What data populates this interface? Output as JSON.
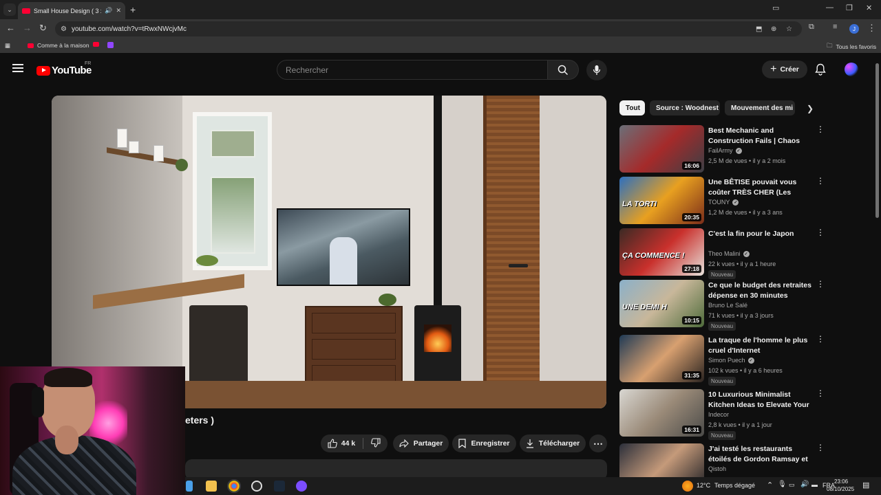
{
  "browser": {
    "tab_title": "Small House Design ( 3 x 7",
    "url": "youtube.com/watch?v=tRwxNWcjvMc",
    "bookmarks": [
      {
        "label": "Comme à la maison",
        "icon": "youtube-icon"
      },
      {
        "label": "",
        "icon": "youtube-icon"
      },
      {
        "label": "",
        "icon": "twitch-icon"
      }
    ],
    "all_bookmarks_label": "Tous les favoris"
  },
  "youtube": {
    "logo_text": "YouTube",
    "region": "FR",
    "search_placeholder": "Rechercher",
    "create_label": "Créer"
  },
  "video": {
    "title_visible": "eters )",
    "likes": "44 k",
    "share_label": "Partager",
    "save_label": "Enregistrer",
    "download_label": "Télécharger"
  },
  "chips": [
    "Tout",
    "Source : Woodnest",
    "Mouvement des mi"
  ],
  "recommendations": [
    {
      "title": "Best Mechanic and Construction Fails | Chaos and...",
      "channel": "FailArmy",
      "verified": true,
      "views": "2,5 M de vues",
      "age": "il y a 2 mois",
      "duration": "16:06",
      "badge": "",
      "thumb_caption": "",
      "colors": [
        "#6b6f78",
        "#a52a2a",
        "#3b3f45"
      ]
    },
    {
      "title": "Une BÊTISE pouvait vous coûter TRÈS CHER (Les machines de ...",
      "channel": "TOUNY",
      "verified": true,
      "views": "1,2 M de vues",
      "age": "il y a 3 ans",
      "duration": "20:35",
      "badge": "",
      "thumb_caption": "LA TORTI",
      "colors": [
        "#2c6fbf",
        "#e8a020",
        "#7a2c1a"
      ]
    },
    {
      "title": "C'est la fin pour le Japon",
      "channel": "Theo Malini",
      "verified": true,
      "views": "22 k vues",
      "age": "il y a 1 heure",
      "duration": "27:18",
      "badge": "Nouveau",
      "thumb_caption": "ÇA COMMENCE !",
      "colors": [
        "#3a2a24",
        "#c9302c",
        "#e7e2dc"
      ]
    },
    {
      "title": "Ce que le budget des retraites dépense en 30 minutes",
      "channel": "Bruno Le Salé",
      "verified": false,
      "views": "71 k vues",
      "age": "il y a 3 jours",
      "duration": "10:15",
      "badge": "Nouveau",
      "thumb_caption": "UNE DEMI H",
      "colors": [
        "#8bb0c9",
        "#c8b79a",
        "#4d6b3a"
      ]
    },
    {
      "title": "La traque de l'homme le plus cruel d'Internet",
      "channel": "Simon Puech",
      "verified": true,
      "views": "102 k vues",
      "age": "il y a 6 heures",
      "duration": "31:35",
      "badge": "Nouveau",
      "thumb_caption": "",
      "colors": [
        "#1f3a55",
        "#d8a070",
        "#2a2320"
      ]
    },
    {
      "title": "10 Luxurious Minimalist Kitchen Ideas to Elevate Your Modern ...",
      "channel": "Indecor",
      "verified": false,
      "views": "2,8 k vues",
      "age": "il y a 1 jour",
      "duration": "16:31",
      "badge": "Nouveau",
      "thumb_caption": "",
      "colors": [
        "#d9d7d2",
        "#9a8a78",
        "#4a4a48"
      ]
    },
    {
      "title": "J'ai testé les restaurants étoilés de Gordon Ramsay et Philippe ...",
      "channel": "Qistoh",
      "verified": false,
      "views": "",
      "age": "",
      "duration": "",
      "badge": "",
      "thumb_caption": "",
      "colors": [
        "#2b2f3a",
        "#c59a7a",
        "#1a1c22"
      ]
    }
  ],
  "taskbar": {
    "temperature": "12°C",
    "weather": "Temps dégagé",
    "language": "FRA",
    "time": "23:06",
    "date": "08/10/2025"
  }
}
